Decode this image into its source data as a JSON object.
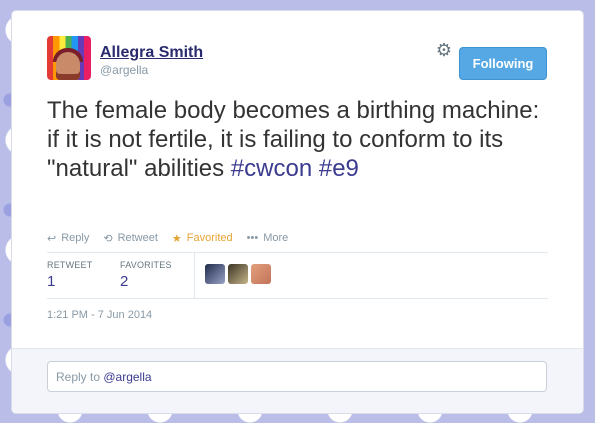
{
  "user": {
    "name": "Allegra Smith",
    "handle": "@argella"
  },
  "follow_button": {
    "label": "Following"
  },
  "tweet": {
    "text_plain": "The female body becomes a birthing machine: if it is not fertile, it is failing to conform to its \"natural\" abilities ",
    "hashtags": [
      "#cwcon",
      "#e9"
    ]
  },
  "actions": {
    "reply": "Reply",
    "retweet": "Retweet",
    "favorite": "Favorited",
    "more": "More"
  },
  "stats": {
    "retweet_label": "RETWEET",
    "retweet_count": "1",
    "favorites_label": "FAVORITES",
    "favorites_count": "2"
  },
  "timestamp": "1:21 PM - 7 Jun 2014",
  "reply_box": {
    "prefix": "Reply to ",
    "mention": "@argella"
  },
  "icons": {
    "reply": "reply-icon",
    "retweet": "retweet-icon",
    "favorite": "star-icon",
    "more": "ellipsis-icon",
    "settings": "gear-icon"
  },
  "colors": {
    "accent": "#56a8e5",
    "favorite": "#e5a334",
    "link": "#3b3b8f"
  }
}
